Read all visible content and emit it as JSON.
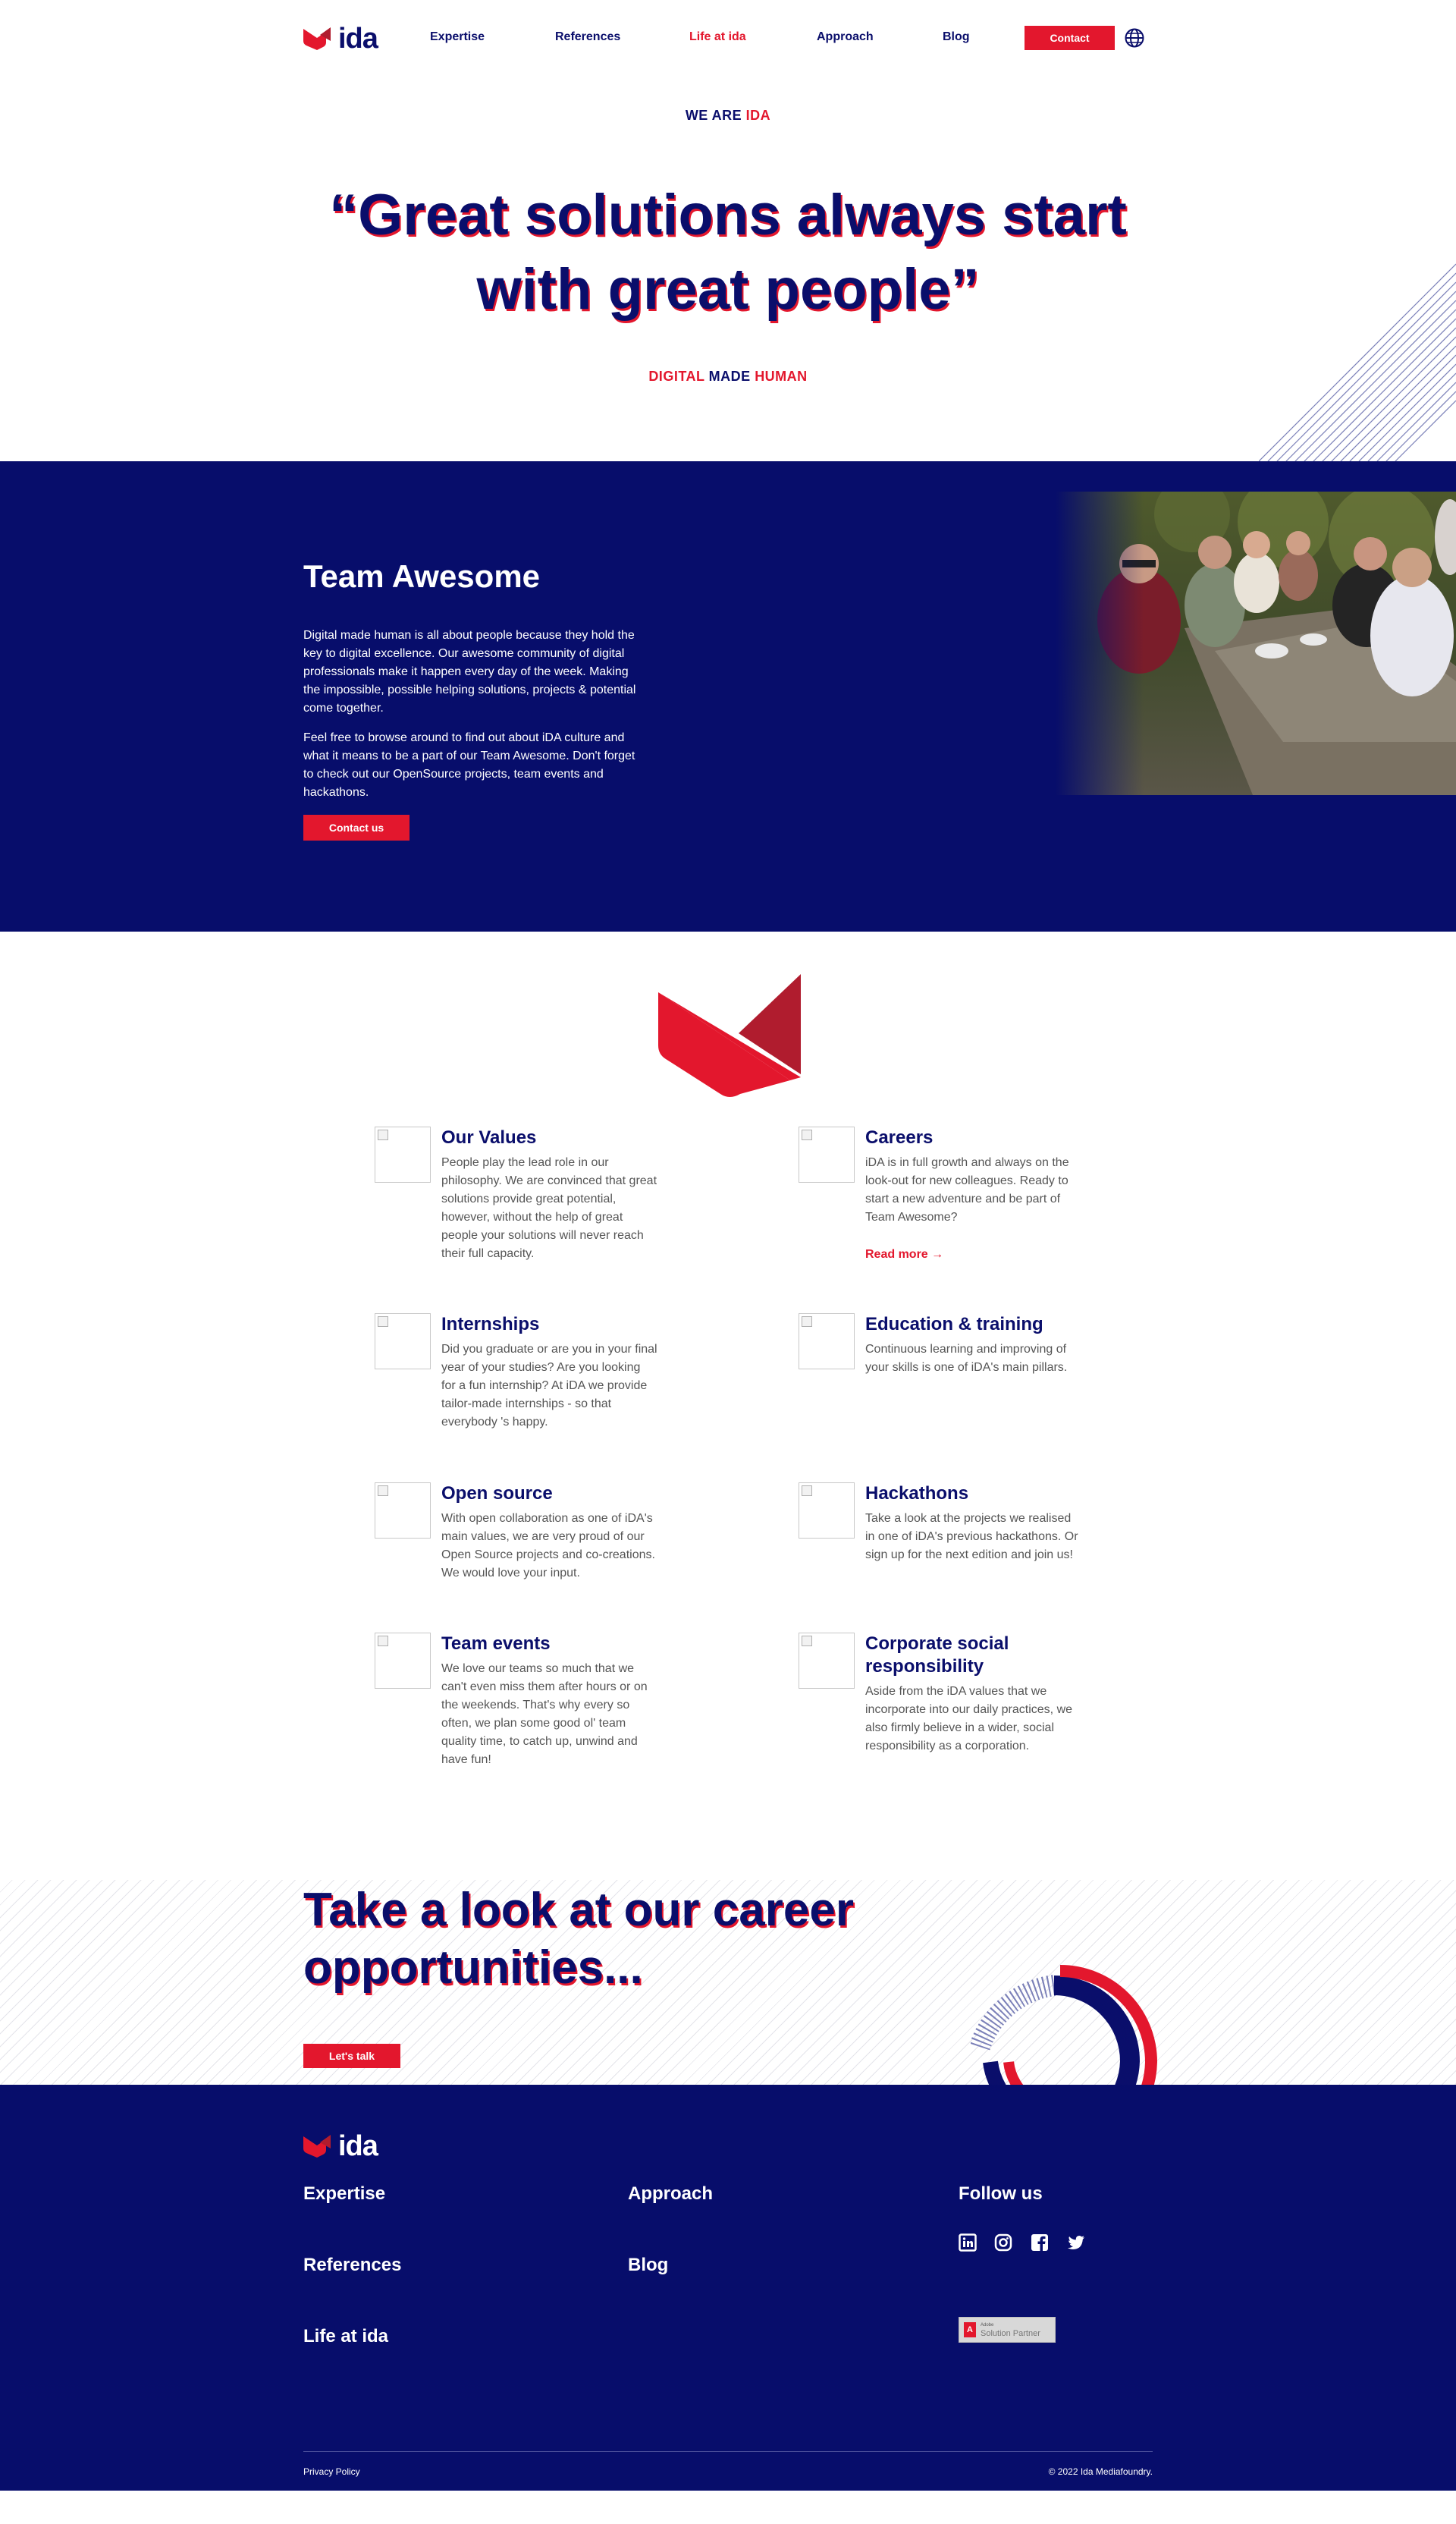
{
  "nav": {
    "logo_text": "ida",
    "links": [
      "Expertise",
      "References",
      "Life at ida",
      "Approach",
      "Blog"
    ],
    "contact_label": "Contact"
  },
  "hero": {
    "eyebrow_a": "WE ARE",
    "eyebrow_b": "IDA",
    "quote": "“Great solutions always start with great people”",
    "tagline_a": "DIGITAL",
    "tagline_b": "MADE",
    "tagline_c": "HUMAN"
  },
  "team": {
    "title": "Team Awesome",
    "p1": "Digital made human is all about people because they hold the key to digital excellence. Our awesome community of digital professionals make it happen every day of the week. Making the impossible, possible helping solutions, projects & potential come together.",
    "p2": "Feel free to browse around to find out about iDA culture and what it means to be a part of our Team Awesome. Don't forget to check out our OpenSource projects, team events and hackathons.",
    "cta": "Contact us"
  },
  "features": [
    {
      "title": "Our Values",
      "text": "People play the lead role in our philosophy. We are convinced that great solutions provide great potential, however, without the help of great people your solutions will never reach their full capacity."
    },
    {
      "title": "Careers",
      "text": "iDA is in full growth and always on the look-out for new colleagues. Ready to start a new adventure and be part of Team Awesome?",
      "more": "Read more →"
    },
    {
      "title": "Internships",
      "text": "Did you graduate or are you in your final year of your studies? Are you looking for a fun internship? At iDA we provide tailor-made internships - so that everybody 's happy."
    },
    {
      "title": "Education & training",
      "text": "Continuous learning and improving of your skills is one of iDA's main pillars."
    },
    {
      "title": "Open source",
      "text": "With open collaboration as one of iDA's main values, we are very proud of our Open Source projects and co-creations. We would love your input."
    },
    {
      "title": "Hackathons",
      "text": "Take a look at the projects we realised in one of iDA's previous hackathons. Or sign up for the next edition and join us!"
    },
    {
      "title": "Team events",
      "text": "We love our teams so much that we can't even miss them after hours or on the weekends. That's why every so often, we plan some good ol' team quality time, to catch up, unwind and have fun!"
    },
    {
      "title": "Corporate social responsibility",
      "text": "Aside from the iDA values that we incorporate into our daily practices, we also firmly believe in a wider, social responsibility as a corporation."
    }
  ],
  "career": {
    "title": "Take a look at our career opportunities...",
    "cta": "Let's talk"
  },
  "footer": {
    "logo_text": "ida",
    "links": [
      "Expertise",
      "Approach",
      "References",
      "Blog",
      "Life at ida"
    ],
    "follow": "Follow us",
    "social_icons": [
      "linkedin-icon",
      "instagram-icon",
      "facebook-icon",
      "twitter-icon"
    ],
    "badge_small": "Adobe",
    "badge_label": "Solution Partner",
    "privacy": "Privacy Policy",
    "copyright": "© 2022 Ida Mediafoundry."
  },
  "colors": {
    "navy": "#0a0e6b",
    "red": "#e3172d"
  }
}
